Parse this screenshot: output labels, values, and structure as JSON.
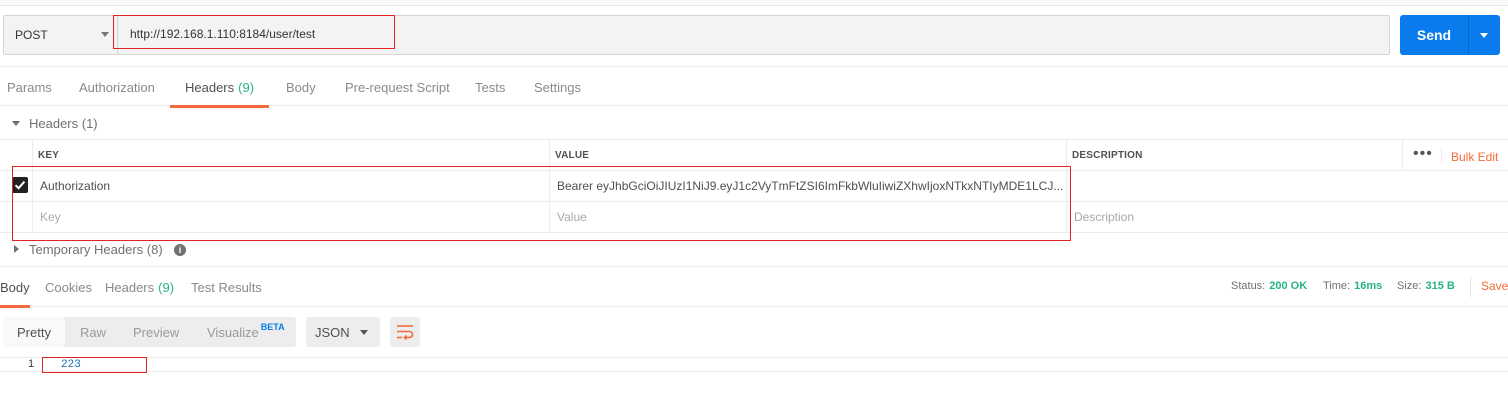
{
  "request": {
    "method": "POST",
    "url": "http://192.168.1.110:8184/user/test",
    "send_label": "Send"
  },
  "request_tabs": [
    {
      "label": "Params"
    },
    {
      "label": "Authorization"
    },
    {
      "label": "Headers",
      "count": "(9)",
      "active": true
    },
    {
      "label": "Body"
    },
    {
      "label": "Pre-request Script"
    },
    {
      "label": "Tests"
    },
    {
      "label": "Settings"
    }
  ],
  "headers_section": {
    "title": "Headers (1)",
    "columns": {
      "key": "KEY",
      "value": "VALUE",
      "description": "DESCRIPTION"
    },
    "bulk_edit": "Bulk Edit",
    "rows": [
      {
        "checked": true,
        "key": "Authorization",
        "value": "Bearer eyJhbGciOiJIUzI1NiJ9.eyJ1c2VyTmFtZSI6ImFkbWluIiwiZXhwIjoxNTkxNTIyMDE1LCJ...",
        "description": ""
      }
    ],
    "new_row_placeholders": {
      "key": "Key",
      "value": "Value",
      "description": "Description"
    },
    "temporary_headers": "Temporary Headers (8)"
  },
  "response_tabs": [
    {
      "label": "Body",
      "active": true
    },
    {
      "label": "Cookies"
    },
    {
      "label": "Headers",
      "count": "(9)"
    },
    {
      "label": "Test Results"
    }
  ],
  "response_meta": {
    "status_label": "Status:",
    "status_value": "200 OK",
    "time_label": "Time:",
    "time_value": "16ms",
    "size_label": "Size:",
    "size_value": "315 B",
    "save_label": "Save"
  },
  "body_toolbar": {
    "formats": [
      "Pretty",
      "Raw",
      "Preview",
      "Visualize"
    ],
    "beta_badge": "BETA",
    "language": "JSON",
    "wrap_icon": "wrap-lines-icon"
  },
  "response_body": {
    "line_number": "1",
    "content": "223"
  },
  "colors": {
    "accent": "#f26b3a",
    "send_button": "#097bed",
    "success": "#26b47f",
    "highlight_box": "#e02424"
  }
}
